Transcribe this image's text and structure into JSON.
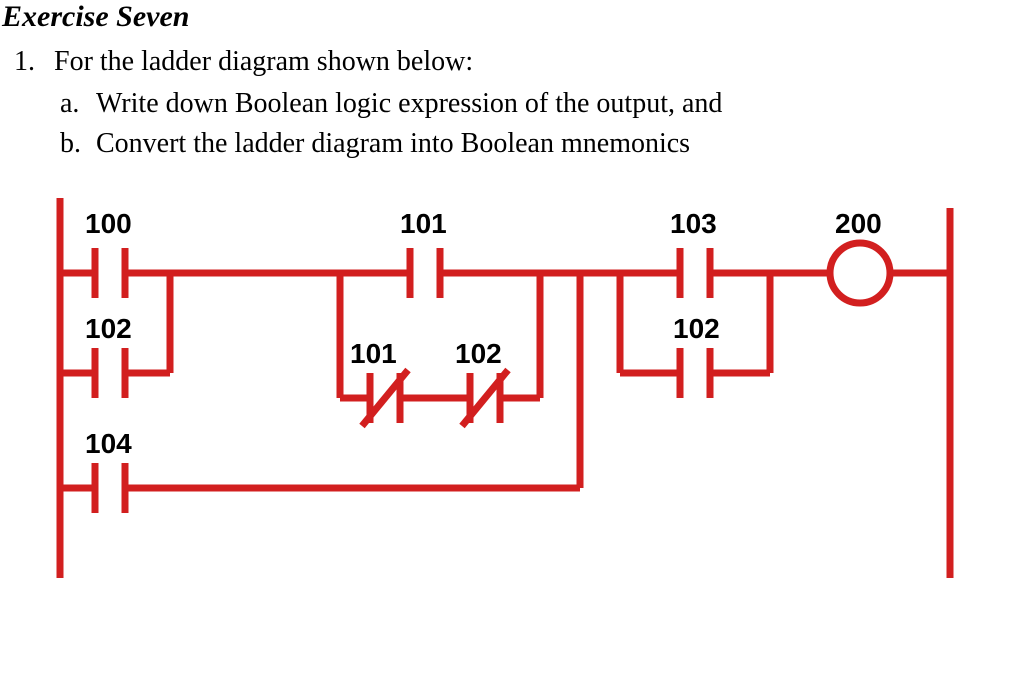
{
  "title": "Exercise Seven",
  "question": {
    "number": "1.",
    "text": "For the ladder diagram shown below:",
    "parts": {
      "a": {
        "letter": "a.",
        "text": "Write down Boolean logic expression of the output, and"
      },
      "b": {
        "letter": "b.",
        "text": "Convert the ladder diagram into Boolean mnemonics"
      }
    }
  },
  "diagram": {
    "labels": {
      "c100": "100",
      "c102a": "102",
      "c104": "104",
      "c101_top": "101",
      "c101b": "101",
      "c102b": "102",
      "c103": "103",
      "c102c": "102",
      "out200": "200"
    }
  },
  "chart_data": {
    "type": "table",
    "description": "PLC ladder diagram with one output rung",
    "rung": {
      "output": {
        "address": "200",
        "type": "coil"
      },
      "logic": "((100 OR 102) AND (101 OR (NOT 101 AND NOT 102)) OR 104) AND (103 OR 102)",
      "branches": {
        "group1": {
          "parallel": [
            {
              "contact": "100",
              "type": "NO"
            },
            {
              "contact": "102",
              "type": "NO"
            }
          ]
        },
        "group2": {
          "parallel": [
            {
              "contact": "101",
              "type": "NO"
            },
            {
              "series": [
                {
                  "contact": "101",
                  "type": "NC"
                },
                {
                  "contact": "102",
                  "type": "NC"
                }
              ]
            }
          ]
        },
        "group12_parallel_with": {
          "contact": "104",
          "type": "NO"
        },
        "group3": {
          "parallel": [
            {
              "contact": "103",
              "type": "NO"
            },
            {
              "contact": "102",
              "type": "NO"
            }
          ]
        }
      }
    }
  }
}
